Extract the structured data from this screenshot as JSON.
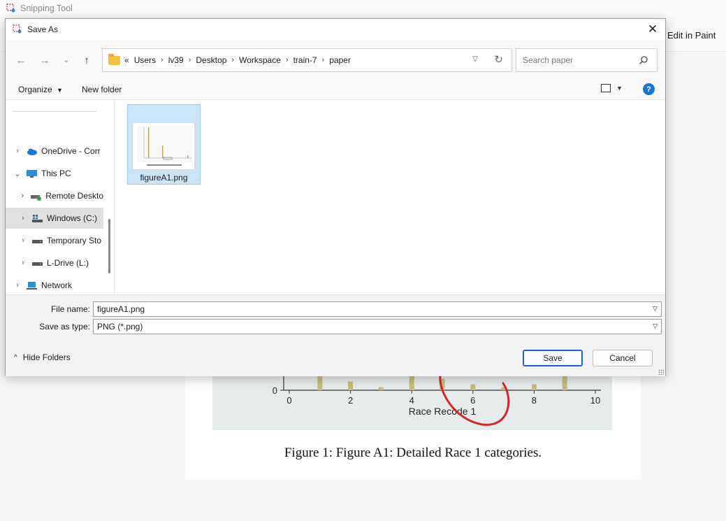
{
  "snipping_tool": {
    "title": "Snipping Tool",
    "edit_in_paint": "Edit in Paint"
  },
  "background_figure": {
    "caption": "Figure 1: Figure A1: Detailed Race 1 categories.",
    "chart_data": {
      "type": "bar",
      "xlabel": "Race Recode 1",
      "x_ticks": [
        "0",
        "2",
        "4",
        "6",
        "8",
        "10"
      ],
      "y_ticks": [
        "0"
      ],
      "xlim": [
        0,
        10
      ],
      "bars_x": [
        1,
        2,
        3,
        4,
        5,
        6,
        7,
        8,
        9
      ],
      "bars_visible_height": [
        1.0,
        0.6,
        0.2,
        1.0,
        0.8,
        0.4,
        0.2,
        0.4,
        1.0
      ],
      "bar_color": "#c8bd7a",
      "annotation": "red hand-drawn circle around x≈6"
    }
  },
  "dialog": {
    "title": "Save As",
    "close_icon": "close-icon",
    "nav": {
      "back_icon": "arrow-left-icon",
      "forward_icon": "arrow-right-icon",
      "recent_icon": "chevron-down-icon",
      "up_icon": "arrow-up-icon"
    },
    "address": {
      "overflow": "«",
      "crumbs": [
        "Users",
        "lv39",
        "Desktop",
        "Workspace",
        "train-7",
        "paper"
      ]
    },
    "search": {
      "placeholder": "Search paper"
    },
    "commands": {
      "organize": "Organize",
      "new_folder": "New folder",
      "help": "?"
    },
    "sidebar": {
      "items": [
        {
          "label": "OneDrive - Corr",
          "icon": "cloud-icon",
          "indent": 0,
          "selected": false
        },
        {
          "label": "This PC",
          "icon": "monitor-icon",
          "indent": 0,
          "selected": false,
          "expanded": true
        },
        {
          "label": "Remote Deskto",
          "icon": "remote-drive-icon",
          "indent": 1,
          "selected": false
        },
        {
          "label": "Windows (C:)",
          "icon": "windows-drive-icon",
          "indent": 1,
          "selected": true
        },
        {
          "label": "Temporary Sto",
          "icon": "drive-icon",
          "indent": 1,
          "selected": false
        },
        {
          "label": "L-Drive (L:)",
          "icon": "drive-icon",
          "indent": 1,
          "selected": false
        },
        {
          "label": "Network",
          "icon": "network-icon",
          "indent": 0,
          "selected": false
        }
      ]
    },
    "files": [
      {
        "name": "figureA1.png"
      }
    ],
    "file_name": {
      "label": "File name:",
      "value": "figureA1.png"
    },
    "save_as_type": {
      "label": "Save as type:",
      "value": "PNG (*.png)"
    },
    "hide_folders": "Hide Folders",
    "save_label": "Save",
    "cancel_label": "Cancel"
  }
}
